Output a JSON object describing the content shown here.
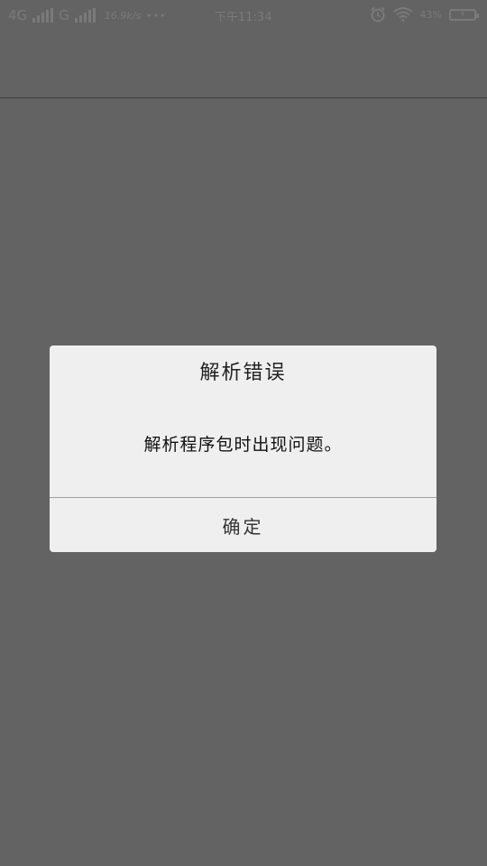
{
  "status_bar": {
    "network_primary": "4G",
    "network_secondary": "G",
    "speed": "16.9k/s",
    "more_dots": "•••",
    "time": "下午11:34",
    "battery_percent": "43%",
    "icons": [
      "signal-icon",
      "alarm-icon",
      "wifi-icon",
      "battery-icon"
    ]
  },
  "dialog": {
    "title": "解析错误",
    "message": "解析程序包时出现问题。",
    "ok_button": "确定"
  },
  "colors": {
    "scrim": "#636363",
    "dialog_bg": "#efefef",
    "divider": "#9e9e9e"
  }
}
